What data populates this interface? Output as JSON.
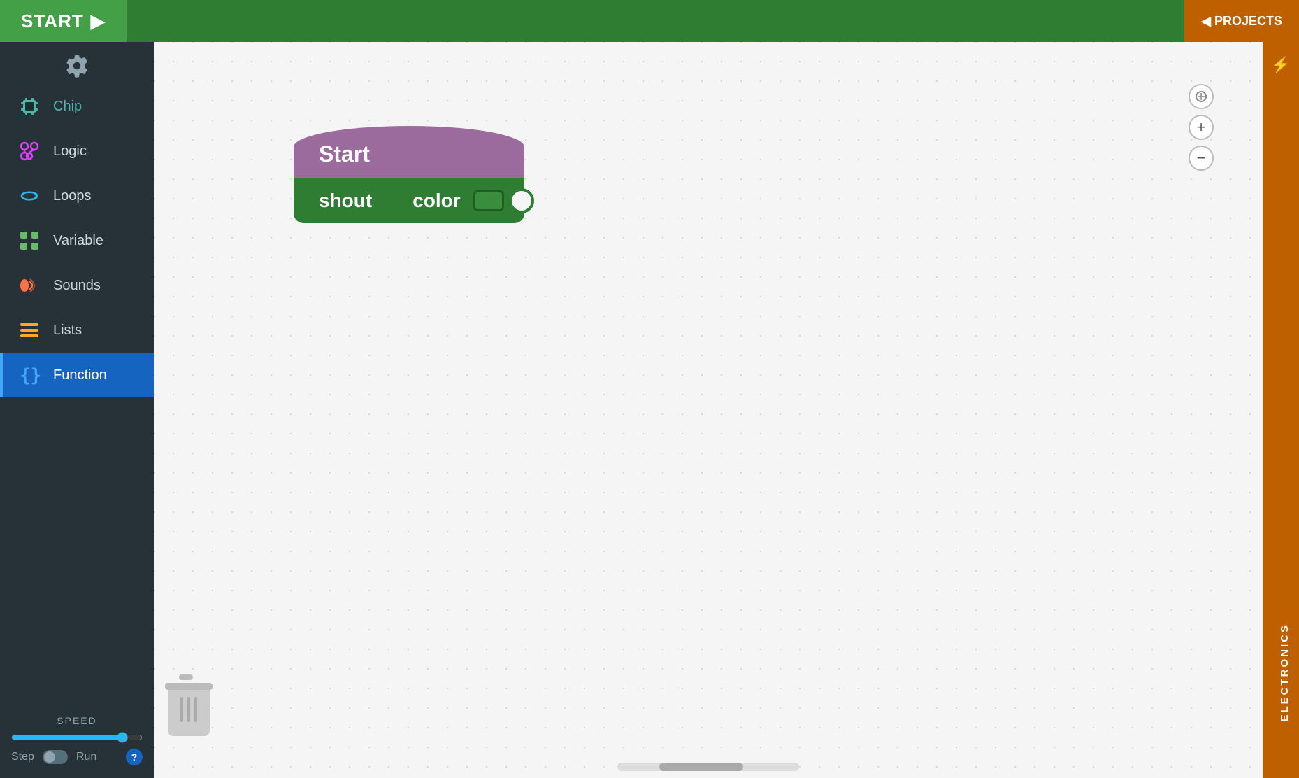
{
  "topbar": {
    "start_label": "START",
    "start_arrow": "▶",
    "projects_label": "◀ PROJECTS"
  },
  "sidebar": {
    "items": [
      {
        "id": "chip",
        "label": "Chip",
        "icon": "chip-icon",
        "active": false
      },
      {
        "id": "logic",
        "label": "Logic",
        "icon": "logic-icon",
        "active": false
      },
      {
        "id": "loops",
        "label": "Loops",
        "icon": "loops-icon",
        "active": false
      },
      {
        "id": "variable",
        "label": "Variable",
        "icon": "variable-icon",
        "active": false
      },
      {
        "id": "sounds",
        "label": "Sounds",
        "icon": "sounds-icon",
        "active": false
      },
      {
        "id": "lists",
        "label": "Lists",
        "icon": "lists-icon",
        "active": false
      },
      {
        "id": "function",
        "label": "Function",
        "icon": "function-icon",
        "active": true
      }
    ],
    "speed": {
      "label": "SPEED",
      "step_label": "Step",
      "run_label": "Run"
    }
  },
  "blocks": {
    "start_label": "Start",
    "shout_label": "shout",
    "color_label": "color",
    "color_value": "#2e7d32"
  },
  "right_panel": {
    "electronics_label": "ELECTRONICS"
  },
  "zoom": {
    "target_symbol": "⊕",
    "plus_symbol": "+",
    "minus_symbol": "−"
  }
}
